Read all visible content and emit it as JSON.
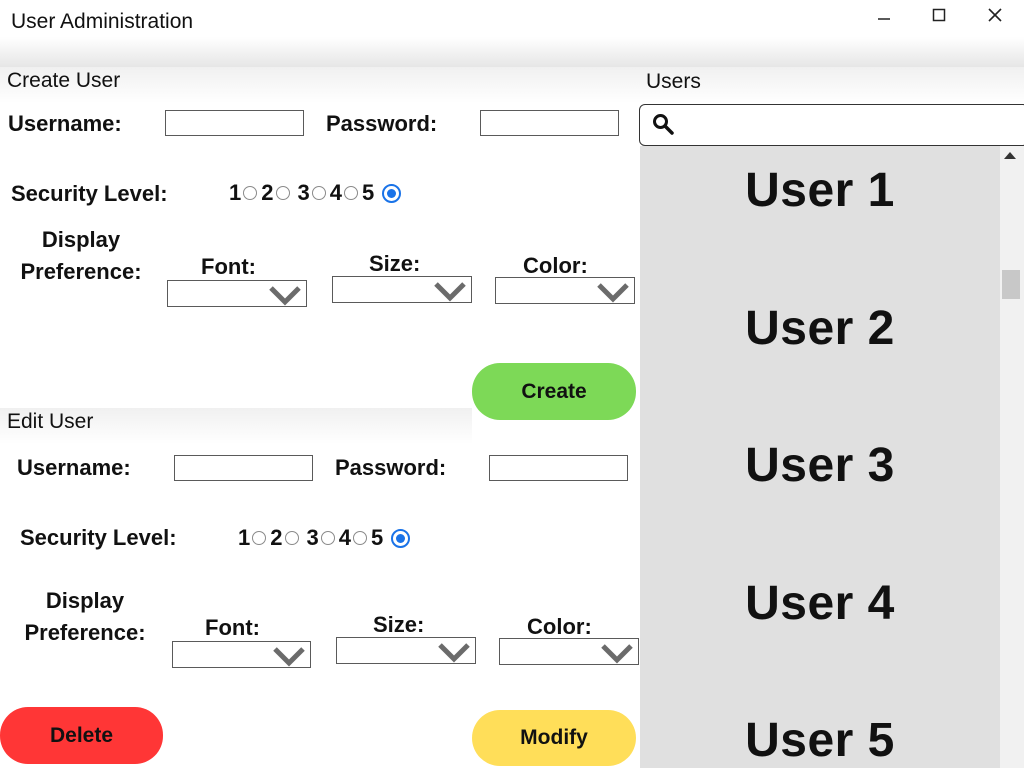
{
  "window": {
    "title": "User Administration",
    "controls": {
      "minimize": "—",
      "maximize": "☐",
      "close": "✕"
    }
  },
  "create_user": {
    "header": "Create User",
    "username_label": "Username:",
    "username_value": "",
    "password_label": "Password:",
    "password_value": "",
    "security_label": "Security Level:",
    "security_options": [
      "1",
      "2",
      "3",
      "4",
      "5"
    ],
    "security_selected": "5",
    "display_label_line1": "Display",
    "display_label_line2": "Preference:",
    "font_label": "Font:",
    "size_label": "Size:",
    "color_label": "Color:",
    "font_value": "",
    "size_value": "",
    "color_value": "",
    "create_button": "Create"
  },
  "edit_user": {
    "header": "Edit User",
    "username_label": "Username:",
    "username_value": "",
    "password_label": "Password:",
    "password_value": "",
    "security_label": "Security Level:",
    "security_options": [
      "1",
      "2",
      "3",
      "4",
      "5"
    ],
    "security_selected": "5",
    "display_label_line1": "Display",
    "display_label_line2": "Preference:",
    "font_label": "Font:",
    "size_label": "Size:",
    "color_label": "Color:",
    "font_value": "",
    "size_value": "",
    "color_value": "",
    "delete_button": "Delete",
    "modify_button": "Modify"
  },
  "users_panel": {
    "header": "Users",
    "search_value": "",
    "search_icon": "search-icon",
    "items": [
      "User 1",
      "User 2",
      "User 3",
      "User 4",
      "User 5"
    ]
  },
  "colors": {
    "create": "#7dd957",
    "delete": "#ff3636",
    "modify": "#ffde59",
    "radio_selected": "#1a73e8",
    "list_background": "#e0e0e0"
  }
}
